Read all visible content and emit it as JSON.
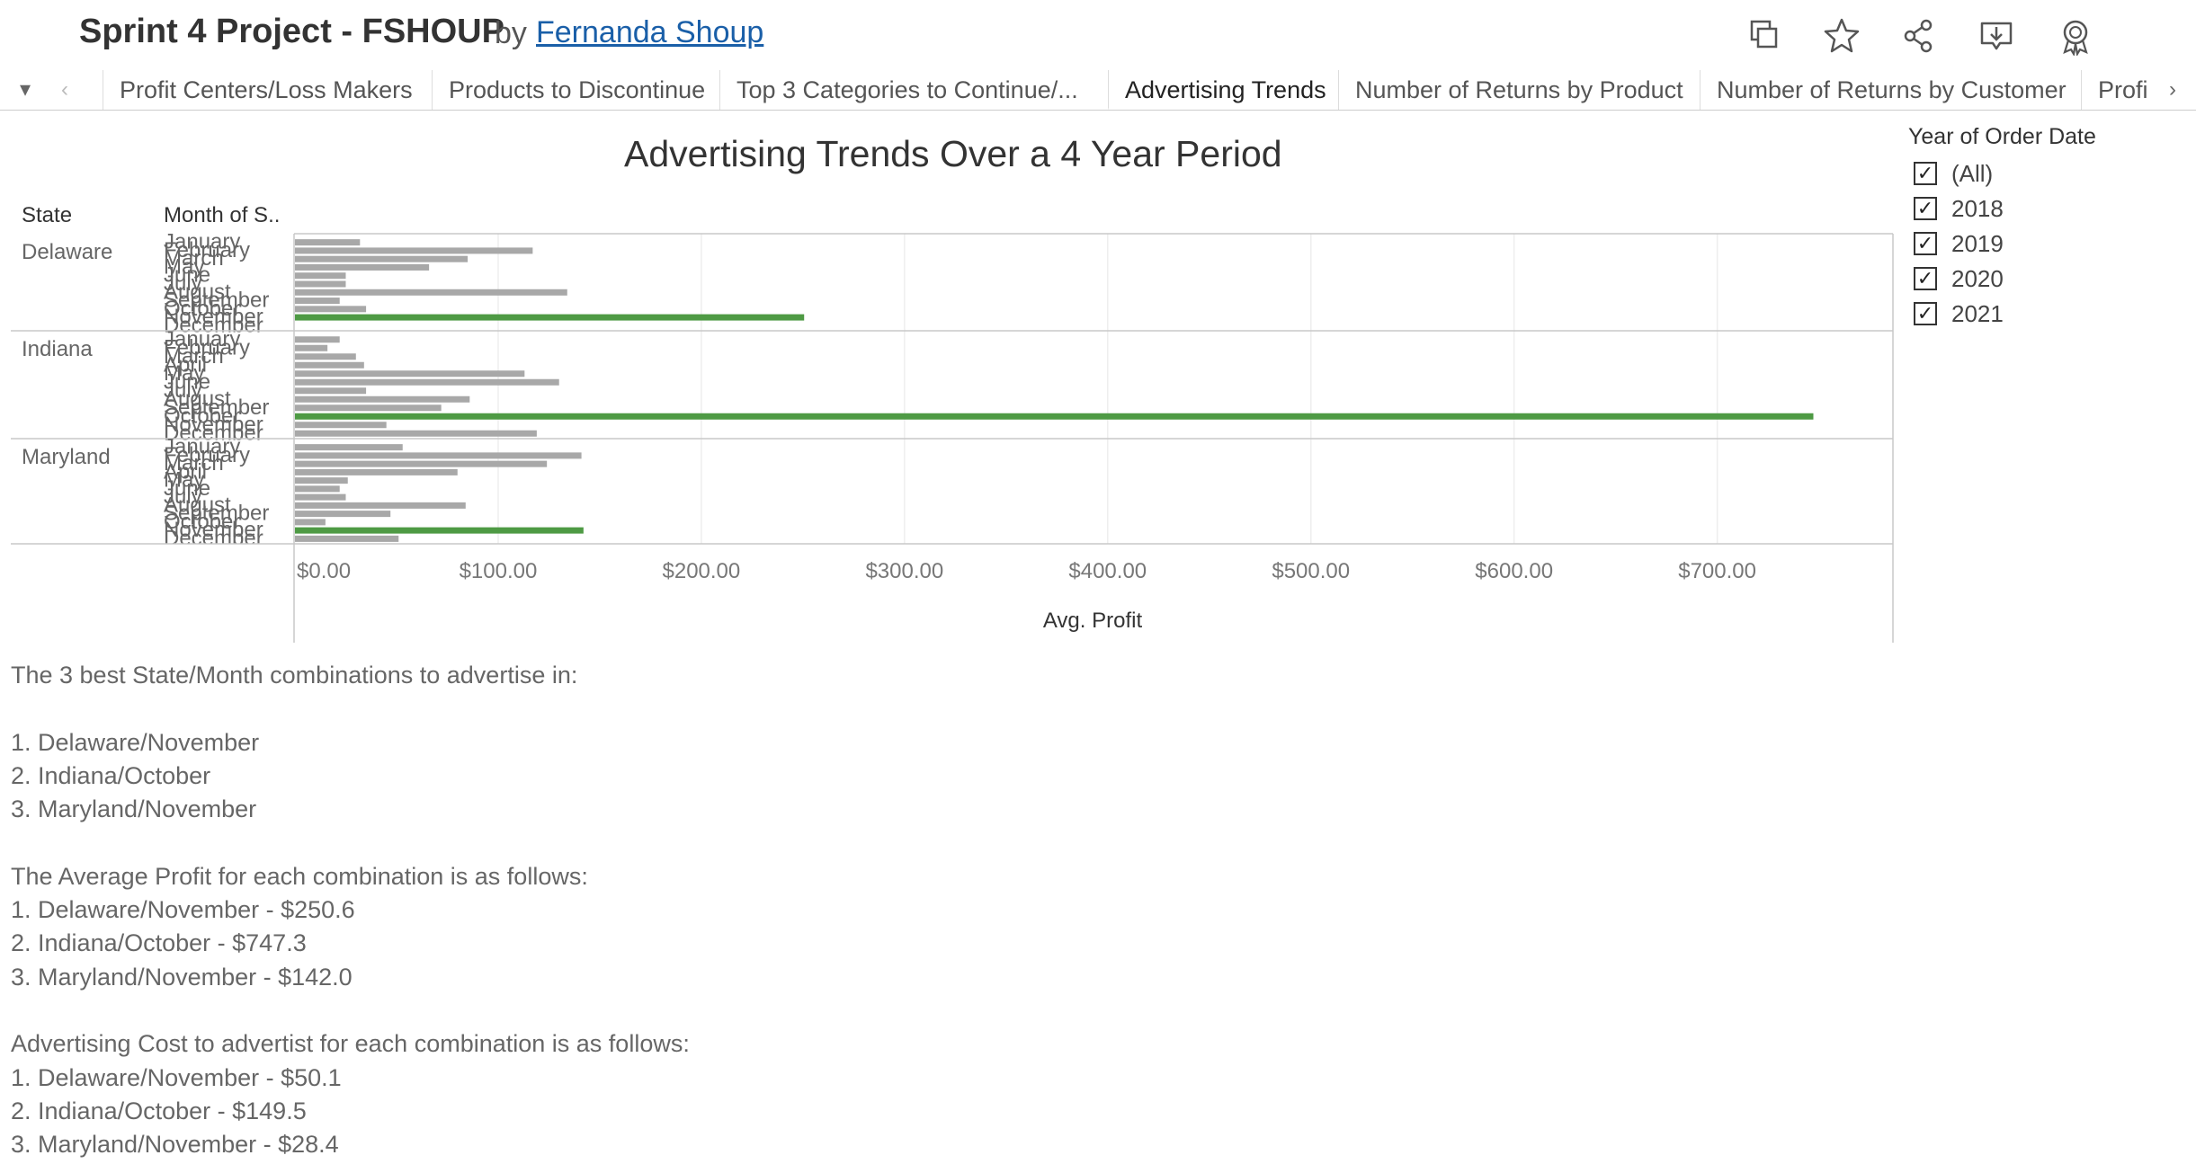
{
  "header": {
    "title": "Sprint 4 Project - FSHOUP",
    "by": "by",
    "author": "Fernanda Shoup",
    "icons": [
      "duplicate-icon",
      "star-icon",
      "share-icon",
      "download-icon",
      "badge-icon"
    ]
  },
  "tabs": [
    {
      "label": "Profit Centers/Loss Makers"
    },
    {
      "label": "Products to Discontinue"
    },
    {
      "label": "Top 3 Categories to Continue/..."
    },
    {
      "label": "Advertising Trends"
    },
    {
      "label": "Number of Returns by Product"
    },
    {
      "label": "Number of Returns by Customer"
    },
    {
      "label": "Profi"
    }
  ],
  "active_tab": "Advertising Trends",
  "filter": {
    "title": "Year of Order Date",
    "items": [
      {
        "label": "(All)",
        "checked": true
      },
      {
        "label": "2018",
        "checked": true
      },
      {
        "label": "2019",
        "checked": true
      },
      {
        "label": "2020",
        "checked": true
      },
      {
        "label": "2021",
        "checked": true
      }
    ]
  },
  "chart_data": {
    "type": "bar",
    "orientation": "horizontal",
    "title": "Advertising Trends Over a 4 Year Period",
    "row_headers": [
      "State",
      "Month of S.."
    ],
    "xlabel": "Avg. Profit",
    "xlim": [
      0,
      780
    ],
    "xticks": [
      "$0.00",
      "$100.00",
      "$200.00",
      "$300.00",
      "$400.00",
      "$500.00",
      "$600.00",
      "$700.00"
    ],
    "xtick_values": [
      0,
      100,
      200,
      300,
      400,
      500,
      600,
      700
    ],
    "colors": {
      "highlight": "#4e9a44",
      "default": "#a8a8a8"
    },
    "grid": true,
    "groups": [
      {
        "state": "Delaware",
        "bars": [
          {
            "month": "January",
            "value": 32
          },
          {
            "month": "February",
            "value": 117
          },
          {
            "month": "March",
            "value": 85
          },
          {
            "month": "May",
            "value": 66
          },
          {
            "month": "June",
            "value": 25
          },
          {
            "month": "July",
            "value": 25
          },
          {
            "month": "August",
            "value": 134
          },
          {
            "month": "September",
            "value": 22
          },
          {
            "month": "October",
            "value": 35
          },
          {
            "month": "November",
            "value": 250.6,
            "highlight": true
          },
          {
            "month": "December",
            "value": 0
          }
        ]
      },
      {
        "state": "Indiana",
        "bars": [
          {
            "month": "January",
            "value": 22
          },
          {
            "month": "February",
            "value": 16
          },
          {
            "month": "March",
            "value": 30
          },
          {
            "month": "April",
            "value": 34
          },
          {
            "month": "May",
            "value": 113
          },
          {
            "month": "June",
            "value": 130
          },
          {
            "month": "July",
            "value": 35
          },
          {
            "month": "August",
            "value": 86
          },
          {
            "month": "September",
            "value": 72
          },
          {
            "month": "October",
            "value": 747.3,
            "highlight": true
          },
          {
            "month": "November",
            "value": 45
          },
          {
            "month": "December",
            "value": 119
          }
        ]
      },
      {
        "state": "Maryland",
        "bars": [
          {
            "month": "January",
            "value": 53
          },
          {
            "month": "February",
            "value": 141
          },
          {
            "month": "March",
            "value": 124
          },
          {
            "month": "April",
            "value": 80
          },
          {
            "month": "May",
            "value": 26
          },
          {
            "month": "June",
            "value": 22
          },
          {
            "month": "July",
            "value": 25
          },
          {
            "month": "August",
            "value": 84
          },
          {
            "month": "September",
            "value": 47
          },
          {
            "month": "October",
            "value": 15
          },
          {
            "month": "November",
            "value": 142.0,
            "highlight": true
          },
          {
            "month": "December",
            "value": 51
          }
        ]
      }
    ]
  },
  "notes": [
    "The 3 best State/Month combinations to advertise in:",
    "",
    "1. Delaware/November",
    "2. Indiana/October",
    "3. Maryland/November",
    "",
    "The Average Profit for each combination is as follows:",
    "1. Delaware/November - $250.6",
    "2. Indiana/October - $747.3",
    "3. Maryland/November - $142.0",
    "",
    "Advertising Cost to advertist for each combination is as follows:",
    "1. Delaware/November - $50.1",
    "2. Indiana/October - $149.5",
    "3. Maryland/November - $28.4"
  ]
}
